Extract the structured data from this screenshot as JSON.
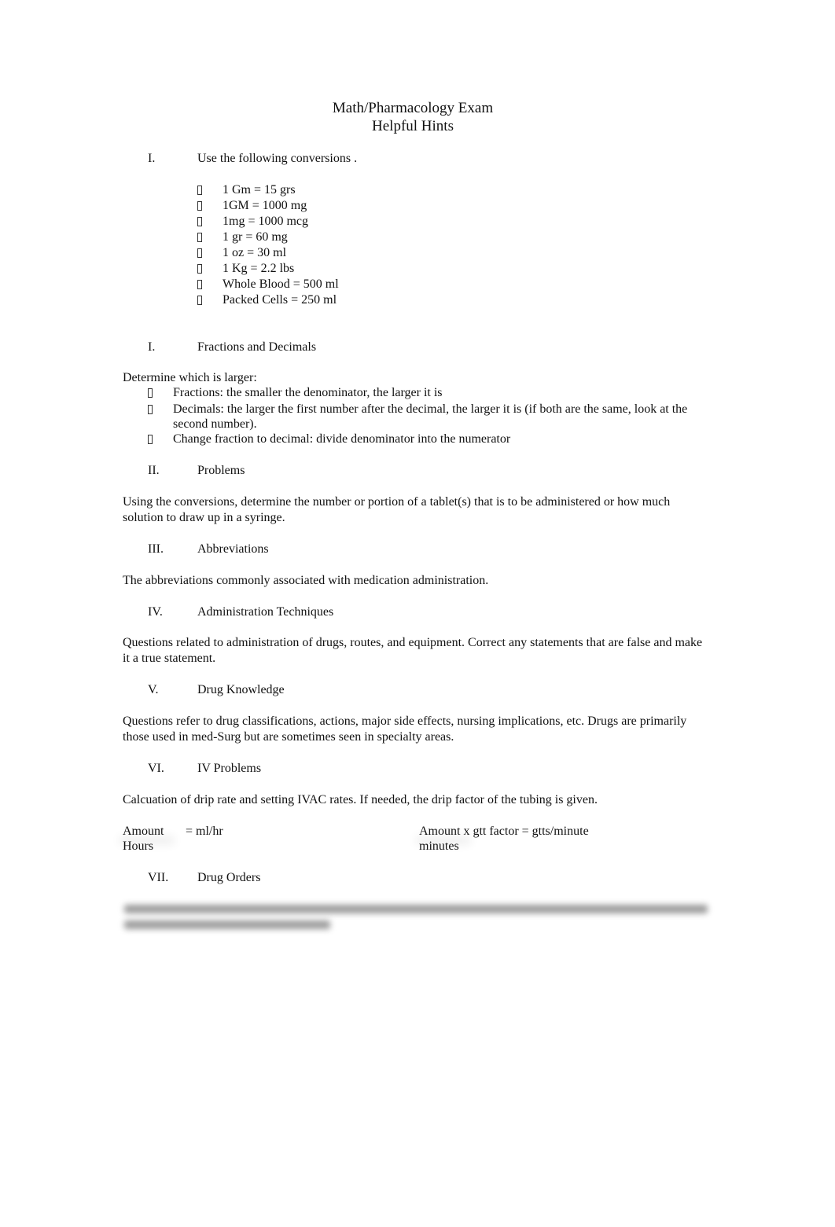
{
  "document": {
    "title_line1": "Math/Pharmacology Exam",
    "title_line2": "Helpful Hints",
    "sections": [
      {
        "numeral": "I.",
        "heading": "Use the following conversions  .",
        "bullet_icon": "missing-glyph-box",
        "items": [
          "1 Gm = 15 grs",
          "1GM = 1000 mg",
          "1mg = 1000 mcg",
          "1 gr = 60 mg",
          "1 oz = 30 ml",
          "1 Kg = 2.2 lbs",
          "Whole Blood = 500 ml",
          "Packed Cells = 250 ml"
        ]
      },
      {
        "numeral": "I.",
        "heading": "Fractions and Decimals",
        "intro": "Determine which is larger:",
        "items": [
          "Fractions:  the smaller the denominator, the larger it is",
          "Decimals:  the larger the first number after the decimal, the larger it is (if both are the same, look at the second number).",
          "Change fraction to decimal: divide denominator into the numerator"
        ]
      },
      {
        "numeral": "II.",
        "heading": "Problems",
        "body": "Using the conversions, determine the number or portion of a tablet(s) that is to be administered or how much solution to draw up in a syringe."
      },
      {
        "numeral": "III.",
        "heading": "Abbreviations",
        "body": "The abbreviations commonly associated with medication administration."
      },
      {
        "numeral": "IV.",
        "heading": "Administration Techniques",
        "body": "Questions related to administration of drugs, routes, and equipment.  Correct any statements that are false and make it a true statement."
      },
      {
        "numeral": "V.",
        "heading": "Drug Knowledge",
        "body": "Questions refer to drug classifications, actions, major side effects, nursing implications, etc.  Drugs are primarily those used in med-Surg but are sometimes seen in specialty areas."
      },
      {
        "numeral": "VI.",
        "heading": "IV Problems",
        "body": "Calcuation of drip rate and setting IVAC rates.  If needed, the drip factor of the tubing is given.",
        "formula_left": {
          "numerator": "Amount",
          "equals": "=  ml/hr",
          "denominator": "Hours"
        },
        "formula_right": {
          "numerator": "Amount x gtt factor = gtts/minute",
          "denominator": "minutes"
        }
      },
      {
        "numeral": "VII.",
        "heading": "Drug Orders",
        "body_obscured": true
      }
    ]
  }
}
